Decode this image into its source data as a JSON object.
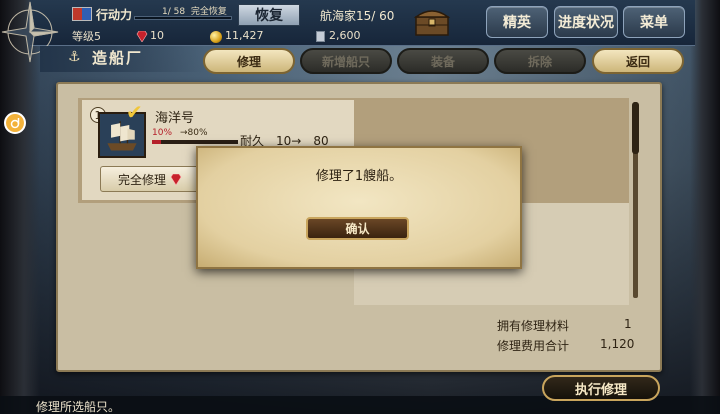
{
  "topbar": {
    "action_power_label": "行动力",
    "action_power_value": "1/ 58",
    "full_recover_label": "完全恢复",
    "restore_button": "恢复",
    "navigator_label": "航海家15/ 60",
    "level_label": "等级5",
    "gems": "10",
    "gold": "11,427",
    "docs": "2,600",
    "elite_button": "精英",
    "progress_button": "进度状况",
    "menu_button": "菜单"
  },
  "yard": {
    "title": "造船厂",
    "tabs": [
      {
        "label": "修理",
        "state": "active"
      },
      {
        "label": "新增船只",
        "state": "disabled"
      },
      {
        "label": "装备",
        "state": "disabled"
      },
      {
        "label": "拆除",
        "state": "disabled"
      },
      {
        "label": "返回",
        "state": "active"
      }
    ]
  },
  "ship": {
    "index": "1",
    "name": "海洋号",
    "durability_from_pct": "10%",
    "durability_to_pct": "→80%",
    "durability_line": "耐久　10→　80",
    "durability_fill": 0.1,
    "full_repair_button": "完全修理"
  },
  "summary": {
    "materials_label": "拥有修理材料",
    "materials_value": "1",
    "cost_label": "修理费用合计",
    "cost_value": "1,120"
  },
  "dialog": {
    "message": "修理了1艘船。",
    "confirm_button": "确认"
  },
  "footer": {
    "hint": "修理所选船只。",
    "execute_button": "执行修理"
  },
  "colors": {
    "accent_gold": "#c9a55d",
    "parchment": "#c9bea3",
    "durability_red": "#b5202a"
  }
}
